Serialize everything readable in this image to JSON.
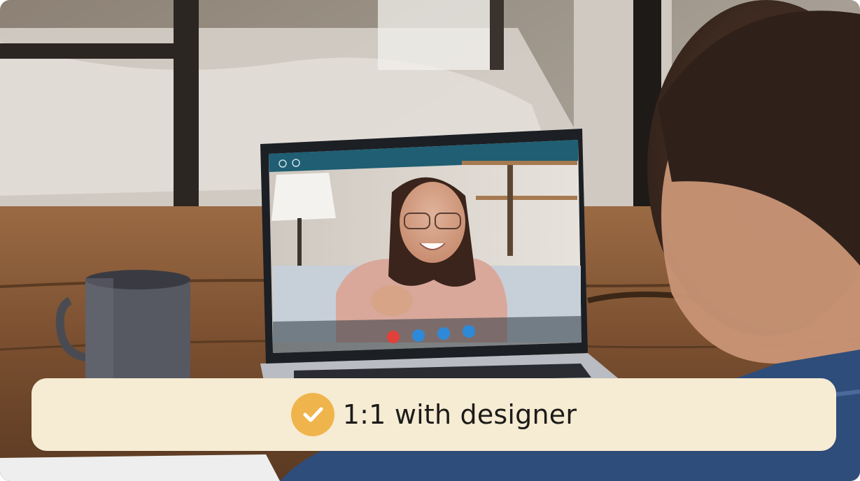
{
  "caption": {
    "text": "1:1 with designer",
    "icon": "check-circle-icon"
  },
  "colors": {
    "caption_bg": "#f6ebd3",
    "check_badge": "#f0b44c",
    "call_end": "#e2403a",
    "call_control": "#2e8ad8",
    "app_header": "#1f5e73"
  },
  "call_window": {
    "controls": [
      "end-call-icon",
      "camera-icon",
      "mic-icon",
      "chat-icon"
    ]
  }
}
